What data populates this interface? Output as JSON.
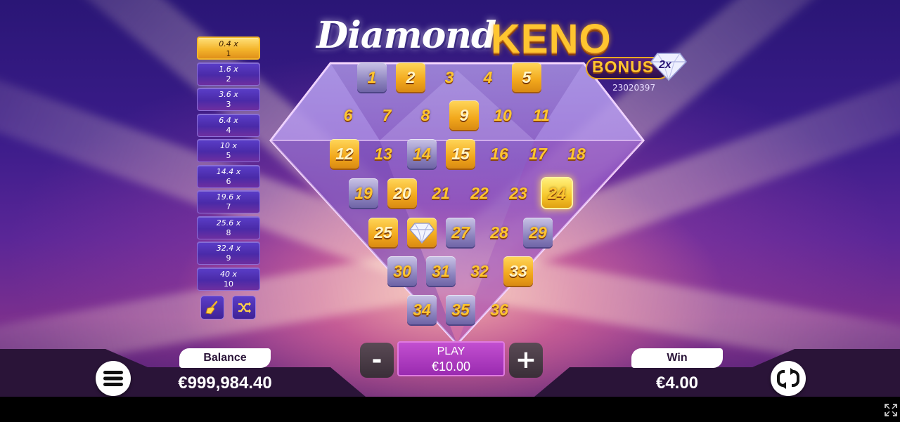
{
  "title": {
    "part1": "Diamond",
    "part2": "KENO"
  },
  "bonus": {
    "label": "BONUS",
    "multiplier": "2x"
  },
  "round_id": "23020397",
  "paytable": [
    {
      "mult": "0.4 x",
      "hits": "1",
      "active": true
    },
    {
      "mult": "1.6 x",
      "hits": "2"
    },
    {
      "mult": "3.6 x",
      "hits": "3"
    },
    {
      "mult": "6.4 x",
      "hits": "4"
    },
    {
      "mult": "10 x",
      "hits": "5"
    },
    {
      "mult": "14.4 x",
      "hits": "6"
    },
    {
      "mult": "19.6 x",
      "hits": "7"
    },
    {
      "mult": "25.6 x",
      "hits": "8"
    },
    {
      "mult": "32.4 x",
      "hits": "9"
    },
    {
      "mult": "40 x",
      "hits": "10"
    }
  ],
  "tools": {
    "clear_icon": "broom-icon",
    "random_icon": "shuffle-icon"
  },
  "grid": [
    {
      "n": "1",
      "state": "silver"
    },
    {
      "n": "2",
      "state": "gold"
    },
    {
      "n": "3",
      "state": "plain"
    },
    {
      "n": "4",
      "state": "plain"
    },
    {
      "n": "5",
      "state": "gold"
    },
    {
      "n": "6",
      "state": "plain"
    },
    {
      "n": "7",
      "state": "plain"
    },
    {
      "n": "8",
      "state": "plain"
    },
    {
      "n": "9",
      "state": "gold"
    },
    {
      "n": "10",
      "state": "plain"
    },
    {
      "n": "11",
      "state": "plain"
    },
    {
      "n": "12",
      "state": "gold"
    },
    {
      "n": "13",
      "state": "plain"
    },
    {
      "n": "14",
      "state": "silver"
    },
    {
      "n": "15",
      "state": "gold"
    },
    {
      "n": "16",
      "state": "plain"
    },
    {
      "n": "17",
      "state": "plain"
    },
    {
      "n": "18",
      "state": "plain"
    },
    {
      "n": "19",
      "state": "silver"
    },
    {
      "n": "20",
      "state": "gold"
    },
    {
      "n": "21",
      "state": "plain"
    },
    {
      "n": "22",
      "state": "plain"
    },
    {
      "n": "23",
      "state": "plain"
    },
    {
      "n": "24",
      "state": "selected"
    },
    {
      "n": "25",
      "state": "gold"
    },
    {
      "n": "",
      "state": "gem"
    },
    {
      "n": "27",
      "state": "silver"
    },
    {
      "n": "28",
      "state": "plain"
    },
    {
      "n": "29",
      "state": "silver"
    },
    {
      "n": "30",
      "state": "silver"
    },
    {
      "n": "31",
      "state": "silver"
    },
    {
      "n": "32",
      "state": "plain"
    },
    {
      "n": "33",
      "state": "gold"
    },
    {
      "n": "34",
      "state": "silver"
    },
    {
      "n": "35",
      "state": "silver"
    },
    {
      "n": "36",
      "state": "plain"
    }
  ],
  "balance": {
    "label": "Balance",
    "value": "€999,984.40"
  },
  "win": {
    "label": "Win",
    "value": "€4.00"
  },
  "play": {
    "label": "PLAY",
    "stake": "€10.00"
  },
  "controls": {
    "minus": "-",
    "plus": "+",
    "menu_icon": "hamburger-menu-icon",
    "autoplay_icon": "autoplay-icon",
    "fullscreen_icon": "fullscreen-icon"
  },
  "colors": {
    "gold": "#ffc530",
    "purple": "#9a2bb0",
    "bar": "#2a1438"
  }
}
